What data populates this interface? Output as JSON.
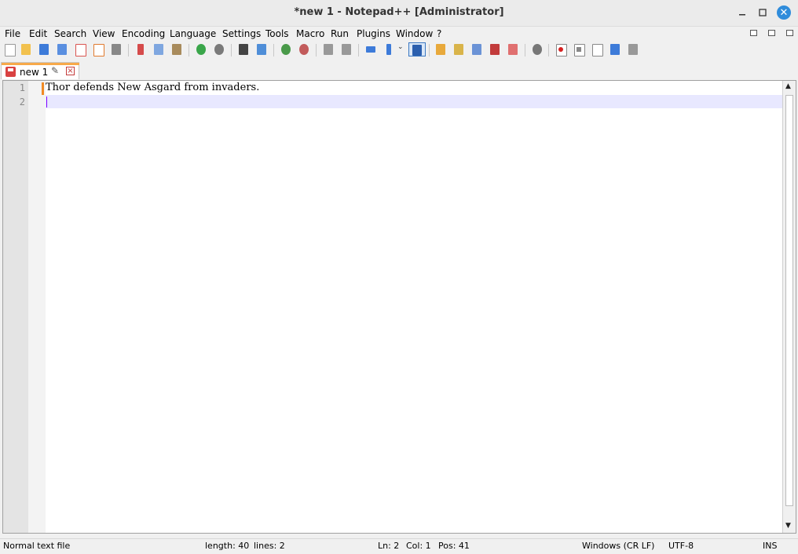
{
  "window": {
    "title": "*new 1 - Notepad++ [Administrator]"
  },
  "menu": [
    "File",
    "Edit",
    "Search",
    "View",
    "Encoding",
    "Language",
    "Settings",
    "Tools",
    "Macro",
    "Run",
    "Plugins",
    "Window",
    "?"
  ],
  "toolbar_icons": [
    "new-file",
    "open-file",
    "save",
    "save-all",
    "close",
    "close-all",
    "print",
    "cut",
    "copy",
    "paste",
    "undo",
    "redo",
    "find",
    "replace",
    "zoom-in",
    "zoom-out",
    "sync-vertical",
    "sync-horizontal",
    "word-wrap",
    "show-all-characters",
    "indent-guide",
    "define-language",
    "document-map",
    "function-list",
    "folder-as-workspace",
    "monitoring",
    "record-macro",
    "stop-recording",
    "playback-macro",
    "run-macro-multiple",
    "save-macro"
  ],
  "tab": {
    "label": "new 1"
  },
  "editor": {
    "lines": [
      {
        "number": "1",
        "text": "Thor defends New Asgard from invaders."
      },
      {
        "number": "2",
        "text": ""
      }
    ]
  },
  "statusbar": {
    "file_type": "Normal text file",
    "length": "length: 40",
    "lines": "lines: 2",
    "ln": "Ln: 2",
    "col": "Col: 1",
    "pos": "Pos: 41",
    "eol": "Windows (CR LF)",
    "encoding": "UTF-8",
    "mode": "INS"
  },
  "colors": {
    "accent": "#f7a94a",
    "close_button": "#2f8cdb",
    "current_line": "#e8e8ff",
    "caret": "#8000ff"
  }
}
